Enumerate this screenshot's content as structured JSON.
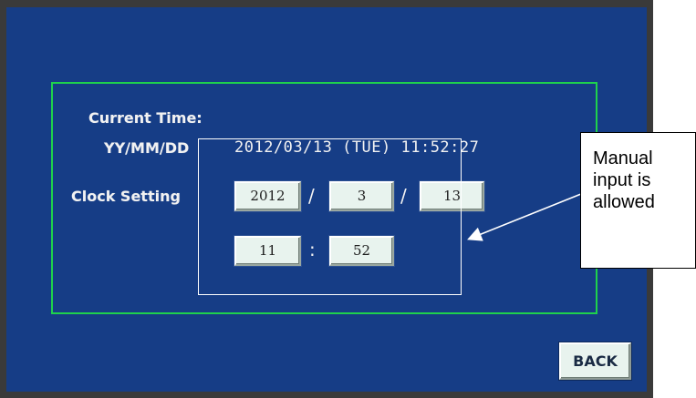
{
  "panel": {
    "current_time_label": "Current Time:",
    "format_label": "YY/MM/DD",
    "current_datetime": "2012/03/13 (TUE) 11:52:27",
    "clock_setting_label": "Clock Setting",
    "date_separator": "/",
    "time_separator": ":",
    "fields": {
      "year": "2012",
      "month": "3",
      "day": "13",
      "hour": "11",
      "minute": "52"
    }
  },
  "back_button_label": "BACK",
  "callout": {
    "lines": [
      "Manual",
      "input  is",
      "allowed"
    ]
  },
  "colors": {
    "screen_bg": "#163d86",
    "panel_border": "#1fd24c",
    "field_bg": "#e8f3ee"
  }
}
